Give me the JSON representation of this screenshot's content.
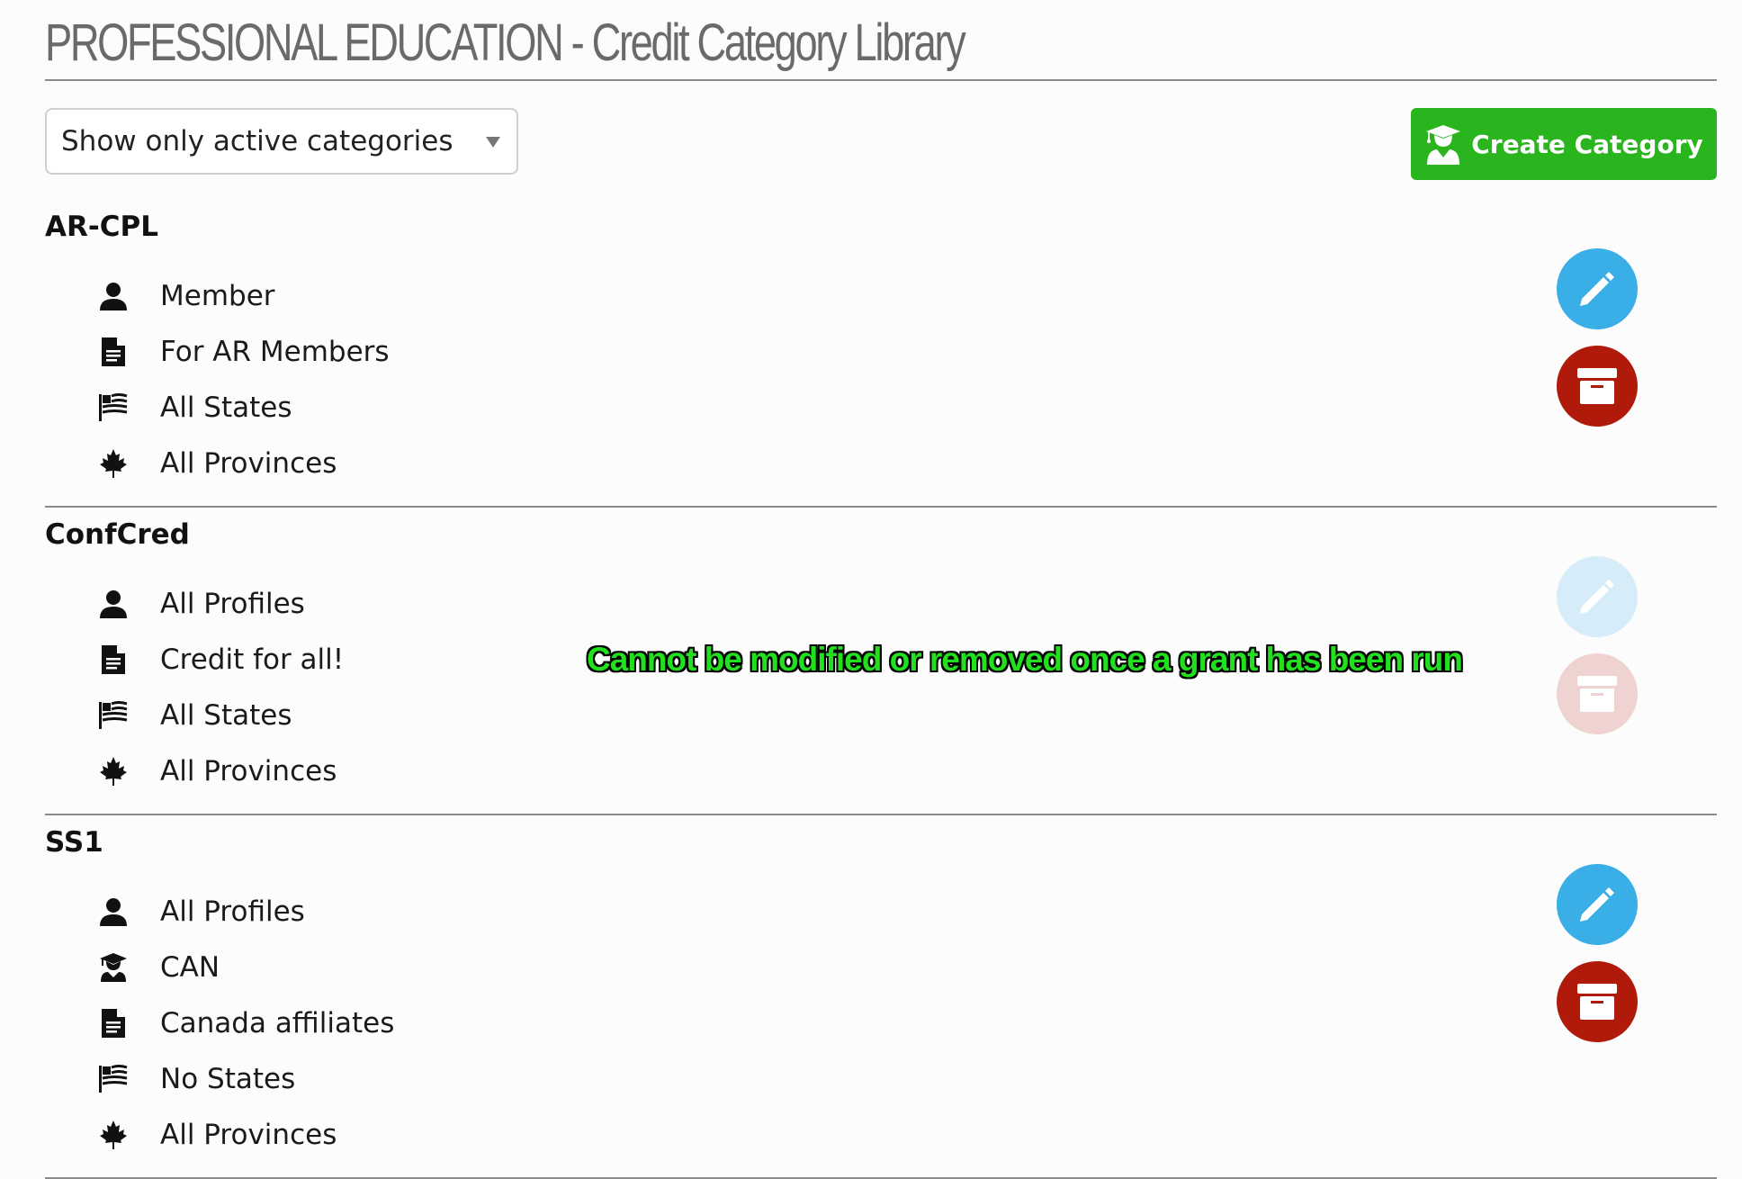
{
  "header": {
    "title": "PROFESSIONAL EDUCATION - Credit Category Library"
  },
  "filter": {
    "selected": "Show only active categories"
  },
  "actions": {
    "create_label": "Create Category",
    "create_icon": "graduate-user-icon"
  },
  "colors": {
    "create": "#2ab41e",
    "edit": "#3aaee7",
    "archive": "#b01a0a",
    "notice": "#22e01e"
  },
  "categories": [
    {
      "name": "AR-CPL",
      "disabled": false,
      "items": [
        {
          "icon": "user-icon",
          "label": "Member"
        },
        {
          "icon": "document-icon",
          "label": "For AR Members"
        },
        {
          "icon": "flag-icon",
          "label": "All States"
        },
        {
          "icon": "maple-leaf-icon",
          "label": "All Provinces"
        }
      ]
    },
    {
      "name": "ConfCred",
      "disabled": true,
      "items": [
        {
          "icon": "user-icon",
          "label": "All Profiles"
        },
        {
          "icon": "document-icon",
          "label": "Credit for all!"
        },
        {
          "icon": "flag-icon",
          "label": "All States"
        },
        {
          "icon": "maple-leaf-icon",
          "label": "All Provinces"
        }
      ]
    },
    {
      "name": "SS1",
      "disabled": false,
      "items": [
        {
          "icon": "user-icon",
          "label": "All Profiles"
        },
        {
          "icon": "graduate-icon",
          "label": "CAN"
        },
        {
          "icon": "document-icon",
          "label": "Canada affiliates"
        },
        {
          "icon": "flag-icon",
          "label": "No States"
        },
        {
          "icon": "maple-leaf-icon",
          "label": "All Provinces"
        }
      ]
    }
  ],
  "notice": "Cannot be modified or removed once a grant has been run"
}
